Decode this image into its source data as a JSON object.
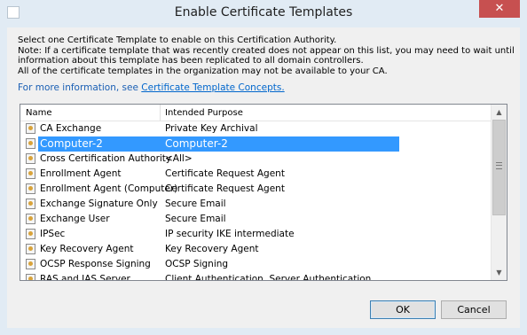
{
  "window": {
    "title": "Enable Certificate Templates",
    "close_label": "✕"
  },
  "description": {
    "line1": "Select one Certificate Template to enable on this Certification Authority.",
    "line2": "Note: If a certificate template that was recently created does not appear on this list, you may need to wait until",
    "line3": "information about this template has been replicated to all domain controllers.",
    "line4": "All of the certificate templates in the organization may not be available to your CA.",
    "more_info_prefix": "For more information, see ",
    "more_info_link": "Certificate Template Concepts."
  },
  "list": {
    "columns": {
      "name": "Name",
      "purpose": "Intended Purpose"
    },
    "rows": [
      {
        "name": "CA Exchange",
        "purpose": "Private Key Archival"
      },
      {
        "name": "Computer-2",
        "purpose": "Computer-2"
      },
      {
        "name": "Cross Certification Authority",
        "purpose": "<All>"
      },
      {
        "name": "Enrollment Agent",
        "purpose": "Certificate Request Agent"
      },
      {
        "name": "Enrollment Agent (Computer)",
        "purpose": "Certificate Request Agent"
      },
      {
        "name": "Exchange Signature Only",
        "purpose": "Secure Email"
      },
      {
        "name": "Exchange User",
        "purpose": "Secure Email"
      },
      {
        "name": "IPSec",
        "purpose": "IP security IKE intermediate"
      },
      {
        "name": "Key Recovery Agent",
        "purpose": "Key Recovery Agent"
      },
      {
        "name": "OCSP Response Signing",
        "purpose": "OCSP Signing"
      },
      {
        "name": "RAS and IAS Server",
        "purpose": "Client Authentication, Server Authentication"
      }
    ],
    "selected_index": 1
  },
  "buttons": {
    "ok": "OK",
    "cancel": "Cancel"
  },
  "colors": {
    "selection": "#3399ff",
    "link": "#0066cc",
    "close_button": "#c75050"
  },
  "icons": {
    "template_row": "certificate-template-icon",
    "scroll_up": "chevron-up-icon",
    "scroll_down": "chevron-down-icon"
  }
}
